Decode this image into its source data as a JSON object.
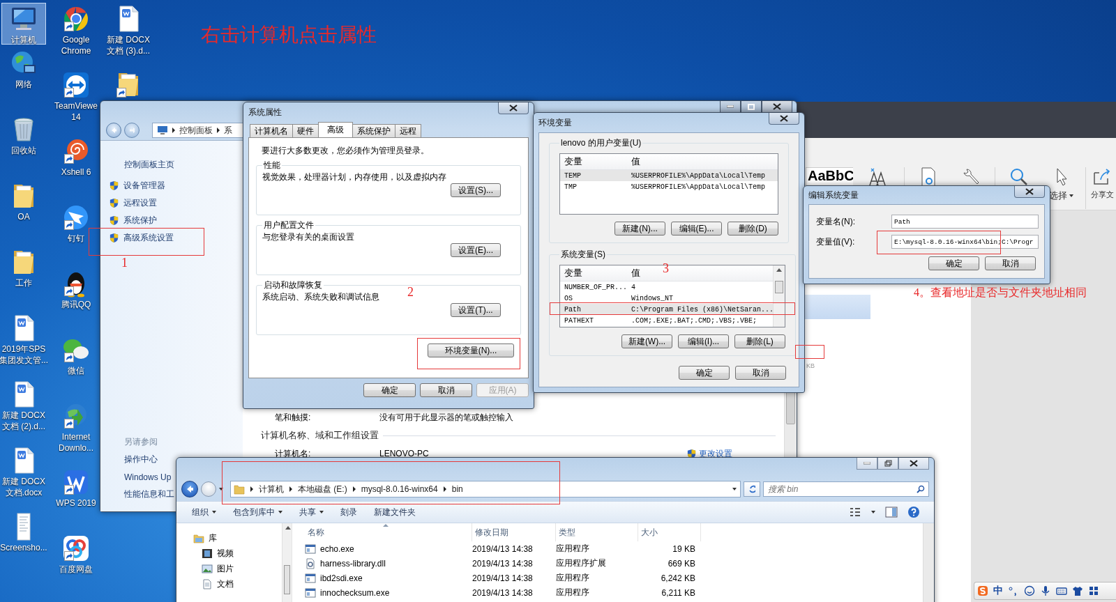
{
  "desktop": {
    "columns": [
      [
        {
          "label": [
            "计算机"
          ],
          "kind": "computer",
          "shortcut": false,
          "selected": true
        },
        {
          "label": [
            "网络"
          ],
          "kind": "network",
          "shortcut": false,
          "selected": false
        },
        {
          "label": [
            "回收站"
          ],
          "kind": "recycle",
          "shortcut": false,
          "selected": false
        },
        {
          "label": [
            "OA"
          ],
          "kind": "folder",
          "shortcut": false,
          "selected": false
        },
        {
          "label": [
            "工作"
          ],
          "kind": "folder",
          "shortcut": false,
          "selected": false
        },
        {
          "label": [
            "2019年SPS",
            "集团发文管..."
          ],
          "kind": "word",
          "shortcut": false,
          "selected": false
        },
        {
          "label": [
            "新建 DOCX",
            "文档 (2).d..."
          ],
          "kind": "word",
          "shortcut": false,
          "selected": false
        },
        {
          "label": [
            "新建 DOCX",
            "文档.docx"
          ],
          "kind": "word",
          "shortcut": false,
          "selected": false
        },
        {
          "label": [
            "Screensho..."
          ],
          "kind": "image",
          "shortcut": false,
          "selected": false
        }
      ],
      [
        {
          "label": [
            "Google",
            "Chrome"
          ],
          "kind": "chrome",
          "shortcut": true,
          "selected": false
        },
        {
          "label": [
            "TeamViewe",
            "14"
          ],
          "kind": "remote",
          "shortcut": true,
          "selected": false
        },
        {
          "label": [
            "Xshell 6"
          ],
          "kind": "shell",
          "shortcut": true,
          "selected": false
        },
        {
          "label": [
            "钉钉"
          ],
          "kind": "wing",
          "shortcut": true,
          "selected": false
        },
        {
          "label": [
            "腾讯QQ"
          ],
          "kind": "oval",
          "shortcut": true,
          "selected": false
        },
        {
          "label": [
            "微信"
          ],
          "kind": "chat",
          "shortcut": true,
          "selected": false
        },
        {
          "label": [
            "Internet",
            "Downlo..."
          ],
          "kind": "download",
          "shortcut": true,
          "selected": false
        },
        {
          "label": [
            "WPS 2019"
          ],
          "kind": "zigzag",
          "shortcut": true,
          "selected": false
        },
        {
          "label": [
            "百度网盘"
          ],
          "kind": "cloud",
          "shortcut": true,
          "selected": false
        }
      ],
      [
        {
          "label": [
            "新建 DOCX",
            "文档 (3).d..."
          ],
          "kind": "word",
          "shortcut": false,
          "selected": false
        },
        {
          "kind": "folder",
          "shortcut": true,
          "selected": false
        }
      ]
    ]
  },
  "control_panel": {
    "breadcrumb": [
      "控制面板",
      "系"
    ],
    "home_link": "控制面板主页",
    "tasks": [
      "设备管理器",
      "远程设置",
      "系统保护",
      "高级系统设置"
    ],
    "see_also_title": "另请参阅",
    "see_also": [
      "操作中心",
      "Windows Up",
      "性能信息和工"
    ],
    "pen_row": {
      "label": "笔和触摸:",
      "value": "没有可用于此显示器的笔或触控输入"
    },
    "section_title": "计算机名称、域和工作组设置",
    "name_row": {
      "label": "计算机名:",
      "value": "LENOVO-PC"
    },
    "change_link": "更改设置"
  },
  "system_properties": {
    "title": "系统属性",
    "tabs": [
      {
        "label": "计算机名",
        "selected": false
      },
      {
        "label": "硬件",
        "selected": false
      },
      {
        "label": "高级",
        "selected": true
      },
      {
        "label": "系统保护",
        "selected": false
      },
      {
        "label": "远程",
        "selected": false
      }
    ],
    "notice": "要进行大多数更改，您必须作为管理员登录。",
    "groups": [
      {
        "title": "性能",
        "description": "视觉效果，处理器计划，内存使用，以及虚拟内存",
        "button": "设置(S)..."
      },
      {
        "title": "用户配置文件",
        "description": "与您登录有关的桌面设置",
        "button": "设置(E)..."
      },
      {
        "title": "启动和故障恢复",
        "description": "系统启动、系统失败和调试信息",
        "button": "设置(T)..."
      }
    ],
    "env_button": "环境变量(N)...",
    "buttons": [
      {
        "label": "确定",
        "disabled": false
      },
      {
        "label": "取消",
        "disabled": false
      },
      {
        "label": "应用(A)",
        "disabled": true
      }
    ]
  },
  "environment_variables": {
    "title": "环境变量",
    "user_group": {
      "title": "lenovo 的用户变量(U)",
      "columns": [
        "变量",
        "值"
      ],
      "rows": [
        {
          "name": "TEMP",
          "value": "%USERPROFILE%\\AppData\\Local\\Temp",
          "selected": true
        },
        {
          "name": "TMP",
          "value": "%USERPROFILE%\\AppData\\Local\\Temp",
          "selected": false
        }
      ],
      "buttons": [
        "新建(N)...",
        "编辑(E)...",
        "删除(D)"
      ]
    },
    "system_group": {
      "title": "系统变量(S)",
      "columns": [
        "变量",
        "值"
      ],
      "rows": [
        {
          "name": "NUMBER_OF_PR...",
          "value": "4",
          "selected": false
        },
        {
          "name": "OS",
          "value": "Windows_NT",
          "selected": false
        },
        {
          "name": "Path",
          "value": "C:\\Program Files (x86)\\NetSaran...",
          "selected": true
        },
        {
          "name": "PATHEXT",
          "value": ".COM;.EXE;.BAT;.CMD;.VBS;.VBE;",
          "selected": false
        }
      ],
      "buttons": [
        "新建(W)...",
        "编辑(I)...",
        "删除(L)"
      ]
    },
    "buttons": [
      "确定",
      "取消"
    ]
  },
  "edit_variable": {
    "title": "编辑系统变量",
    "fields": [
      {
        "label": "变量名(N):",
        "value": "Path"
      },
      {
        "label": "变量值(V):",
        "value": "E:\\mysql-8.0.16-winx64\\bin;C:\\Progr"
      }
    ],
    "buttons": [
      "确定",
      "取消"
    ]
  },
  "background_app": {
    "style_preview": "AaBbC",
    "select_label": "选择",
    "share_label": "分享文",
    "size_unit": "KB"
  },
  "explorer": {
    "breadcrumb": [
      "计算机",
      "本地磁盘 (E:)",
      "mysql-8.0.16-winx64",
      "bin"
    ],
    "search": {
      "placeholder": "搜索 bin"
    },
    "toolbar": [
      {
        "label": "组织",
        "dropdown": true
      },
      {
        "label": "包含到库中",
        "dropdown": true
      },
      {
        "label": "共享",
        "dropdown": true
      },
      {
        "label": "刻录",
        "dropdown": false
      },
      {
        "label": "新建文件夹",
        "dropdown": false
      }
    ],
    "nav": [
      {
        "label": "库",
        "kind": "library",
        "children": [
          {
            "label": "视频",
            "kind": "video"
          },
          {
            "label": "图片",
            "kind": "image"
          },
          {
            "label": "文档",
            "kind": "document"
          }
        ]
      }
    ],
    "columns": [
      "名称",
      "修改日期",
      "类型",
      "大小"
    ],
    "files": [
      {
        "name": "echo.exe",
        "modified": "2019/4/13 14:38",
        "type": "应用程序",
        "size": "19 KB",
        "kind": "exe"
      },
      {
        "name": "harness-library.dll",
        "modified": "2019/4/13 14:38",
        "type": "应用程序扩展",
        "size": "669 KB",
        "kind": "dll"
      },
      {
        "name": "ibd2sdi.exe",
        "modified": "2019/4/13 14:38",
        "type": "应用程序",
        "size": "6,242 KB",
        "kind": "exe"
      },
      {
        "name": "innochecksum.exe",
        "modified": "2019/4/13 14:38",
        "type": "应用程序",
        "size": "6,211 KB",
        "kind": "exe"
      }
    ]
  },
  "annotations": {
    "texts": [
      "右击计算机点击属性",
      "1",
      "2",
      "3",
      "4。查看地址是否与文件夹地址相同"
    ]
  },
  "ime_bar": {
    "mode": "中"
  }
}
